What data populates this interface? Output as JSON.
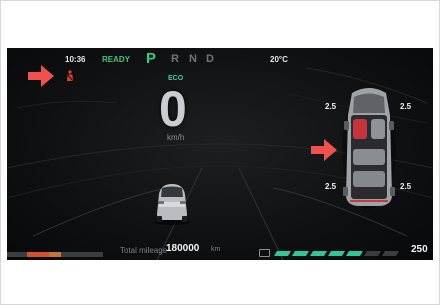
{
  "status": {
    "time": "10:36",
    "ready": "READY",
    "temperature": "20°C"
  },
  "gears": {
    "p": "P",
    "r": "R",
    "n": "N",
    "d": "D",
    "selected": "P"
  },
  "drive": {
    "mode": "ECO",
    "speed": "0",
    "speed_unit": "km/h"
  },
  "tires": {
    "front_left": "2.5",
    "front_right": "2.5",
    "rear_left": "2.5",
    "rear_right": "2.5"
  },
  "odometer": {
    "label": "Total mileage",
    "value": "180000",
    "unit": "km"
  },
  "range": {
    "value": "250"
  },
  "colors": {
    "accent_green": "#2fd07a",
    "eco_teal": "#3ccf9c",
    "warning_red": "#e23b3b",
    "callout_arrow": "#f0514f"
  },
  "icons": [
    "seatbelt-warning-icon",
    "battery-icon",
    "callout-arrow-icon"
  ]
}
